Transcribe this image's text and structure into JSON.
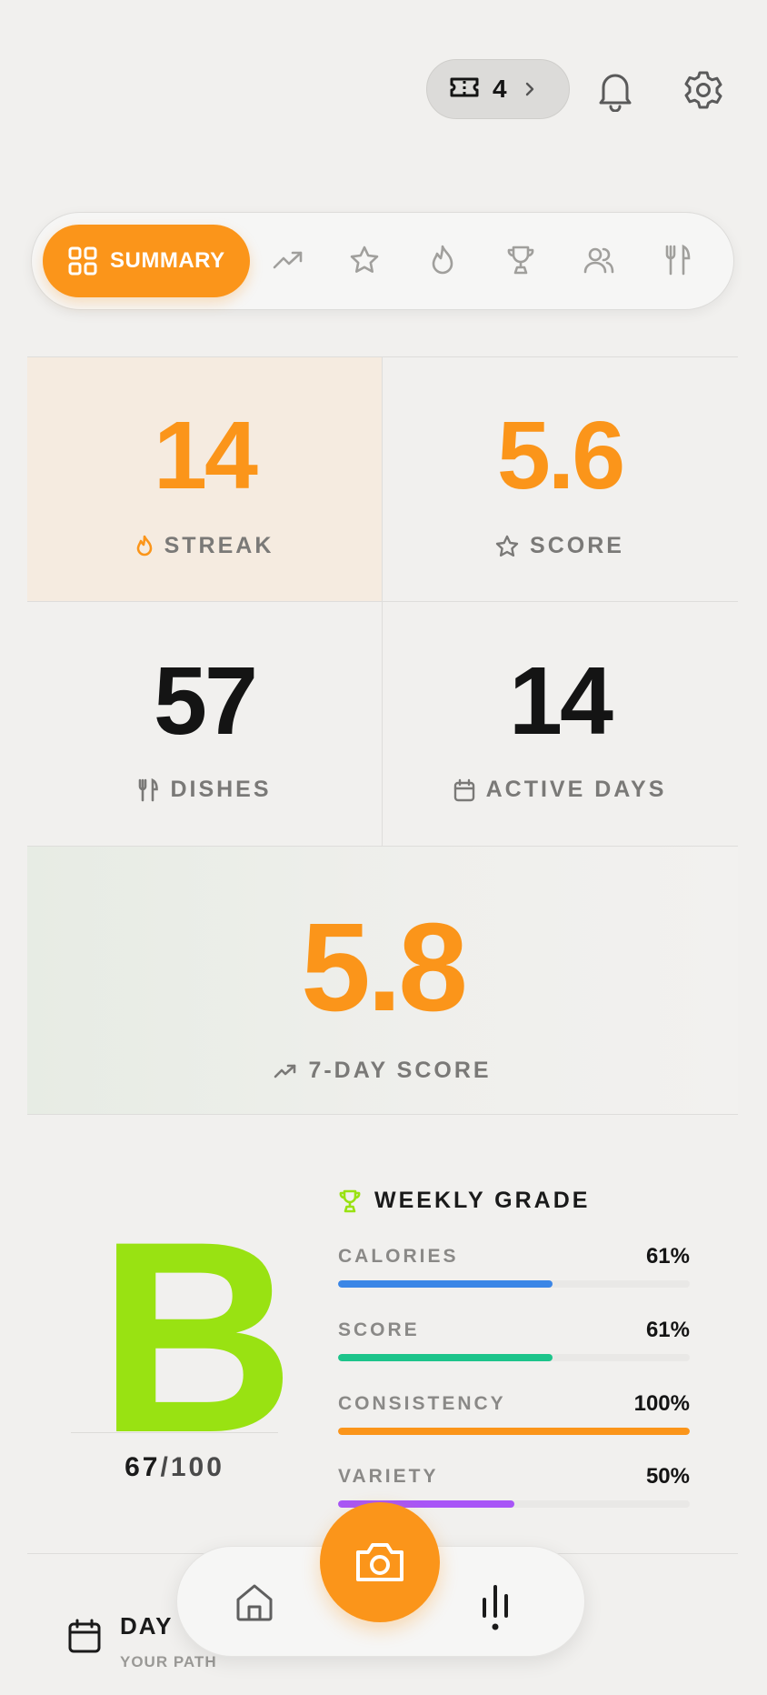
{
  "header": {
    "tokens_count": "4"
  },
  "tabs": {
    "active_label": "SUMMARY"
  },
  "stats": {
    "streak": {
      "value": "14",
      "label": "STREAK"
    },
    "score": {
      "value": "5.6",
      "label": "SCORE"
    },
    "dishes": {
      "value": "57",
      "label": "DISHES"
    },
    "active_days": {
      "value": "14",
      "label": "ACTIVE DAYS"
    },
    "seven_day": {
      "value": "5.8",
      "label": "7-DAY SCORE"
    }
  },
  "grade": {
    "letter": "B",
    "points": "67",
    "max": "/100",
    "title": "WEEKLY GRADE",
    "metrics": [
      {
        "name": "CALORIES",
        "pct": "61%",
        "fill": 0.61,
        "color": "#3b86e6"
      },
      {
        "name": "SCORE",
        "pct": "61%",
        "fill": 0.61,
        "color": "#1cc48a"
      },
      {
        "name": "CONSISTENCY",
        "pct": "100%",
        "fill": 1.0,
        "color": "#fb951a"
      },
      {
        "name": "VARIETY",
        "pct": "50%",
        "fill": 0.5,
        "color": "#a855f7"
      }
    ]
  },
  "day_section": {
    "title": "DAY",
    "subtitle": "YOUR PATH"
  },
  "colors": {
    "accent": "#fb951a",
    "grade": "#99e212"
  }
}
